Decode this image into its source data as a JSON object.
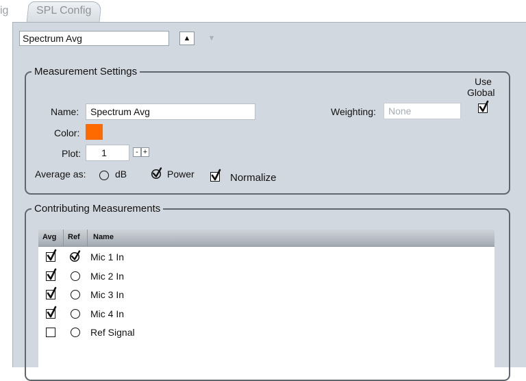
{
  "tabs": {
    "prev_fragment": "ig",
    "active": "SPL Config"
  },
  "selector": {
    "value": "Spectrum Avg"
  },
  "measurement_settings": {
    "legend": "Measurement Settings",
    "use_global_line1": "Use",
    "use_global_line2": "Global",
    "use_global_checked": true,
    "name_label": "Name:",
    "name_value": "Spectrum Avg",
    "weighting_label": "Weighting:",
    "weighting_placeholder": "None",
    "color_label": "Color:",
    "color_value": "#ff6a00",
    "plot_label": "Plot:",
    "plot_value": "1",
    "decrement_label": "-",
    "increment_label": "+",
    "average_label": "Average as:",
    "option_db": "dB",
    "option_power": "Power",
    "selected_option": "Power",
    "normalize_label": "Normalize",
    "normalize_checked": true
  },
  "contributing": {
    "legend": "Contributing Measurements",
    "columns": [
      "Avg",
      "Ref",
      "Name"
    ],
    "rows": [
      {
        "avg": true,
        "ref": true,
        "name": "Mic 1 In"
      },
      {
        "avg": true,
        "ref": false,
        "name": "Mic 2 In"
      },
      {
        "avg": true,
        "ref": false,
        "name": "Mic 3 In"
      },
      {
        "avg": true,
        "ref": false,
        "name": "Mic 4 In"
      },
      {
        "avg": false,
        "ref": false,
        "name": "Ref Signal"
      }
    ]
  }
}
